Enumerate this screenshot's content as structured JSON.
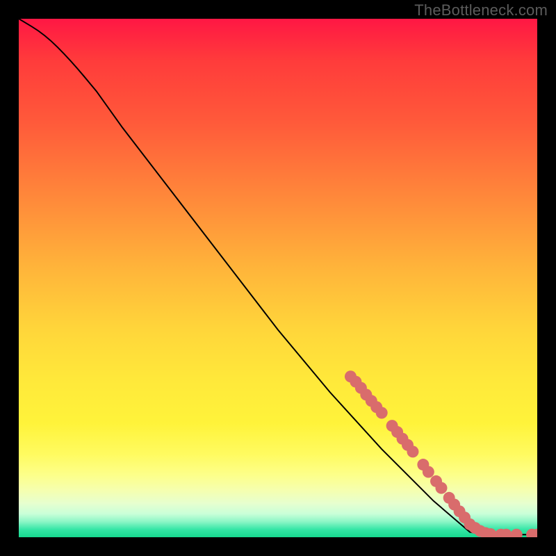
{
  "watermark": "TheBottleneck.com",
  "chart_data": {
    "type": "line",
    "title": "",
    "xlabel": "",
    "ylabel": "",
    "xlim": [
      0,
      100
    ],
    "ylim": [
      0,
      100
    ],
    "grid": false,
    "curve": [
      {
        "x": 0,
        "y": 100
      },
      {
        "x": 5,
        "y": 97
      },
      {
        "x": 10,
        "y": 92
      },
      {
        "x": 15,
        "y": 86
      },
      {
        "x": 20,
        "y": 79
      },
      {
        "x": 30,
        "y": 66
      },
      {
        "x": 40,
        "y": 53
      },
      {
        "x": 50,
        "y": 40
      },
      {
        "x": 60,
        "y": 28
      },
      {
        "x": 70,
        "y": 17
      },
      {
        "x": 80,
        "y": 7
      },
      {
        "x": 87,
        "y": 1
      },
      {
        "x": 90,
        "y": 0.5
      },
      {
        "x": 100,
        "y": 0.5
      }
    ],
    "scatter_points": [
      {
        "x": 64,
        "y": 31
      },
      {
        "x": 65,
        "y": 30
      },
      {
        "x": 66,
        "y": 28.8
      },
      {
        "x": 67,
        "y": 27.5
      },
      {
        "x": 68,
        "y": 26.3
      },
      {
        "x": 69,
        "y": 25.1
      },
      {
        "x": 70,
        "y": 24
      },
      {
        "x": 72,
        "y": 21.5
      },
      {
        "x": 73,
        "y": 20.3
      },
      {
        "x": 74,
        "y": 19
      },
      {
        "x": 75,
        "y": 17.8
      },
      {
        "x": 76,
        "y": 16.5
      },
      {
        "x": 78,
        "y": 14
      },
      {
        "x": 79,
        "y": 12.6
      },
      {
        "x": 80.5,
        "y": 10.8
      },
      {
        "x": 81.5,
        "y": 9.5
      },
      {
        "x": 83,
        "y": 7.6
      },
      {
        "x": 84,
        "y": 6.3
      },
      {
        "x": 85,
        "y": 5
      },
      {
        "x": 86,
        "y": 3.8
      },
      {
        "x": 87,
        "y": 2.5
      },
      {
        "x": 88,
        "y": 1.8
      },
      {
        "x": 89,
        "y": 1.2
      },
      {
        "x": 90,
        "y": 0.8
      },
      {
        "x": 91,
        "y": 0.6
      },
      {
        "x": 93,
        "y": 0.5
      },
      {
        "x": 94,
        "y": 0.5
      },
      {
        "x": 96,
        "y": 0.5
      },
      {
        "x": 99,
        "y": 0.5
      },
      {
        "x": 100,
        "y": 0.5
      }
    ],
    "point_color": "#d96c6c",
    "line_color": "#000000"
  }
}
